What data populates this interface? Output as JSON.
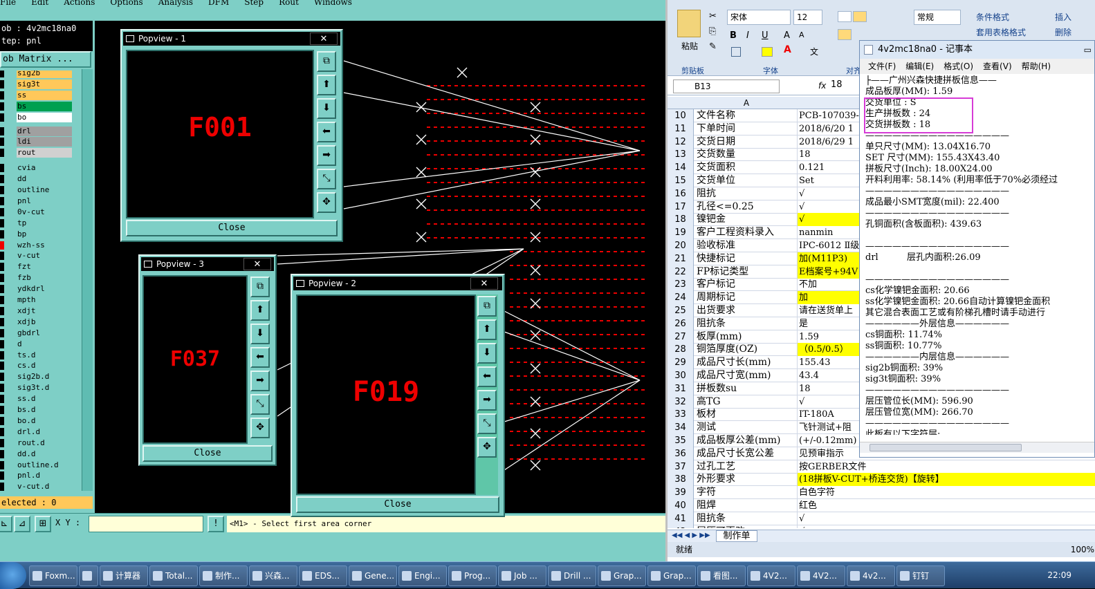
{
  "cam": {
    "menu": [
      "File",
      "Edit",
      "Actions",
      "Options",
      "Analysis",
      "DFM",
      "Step",
      "Rout",
      "Windows"
    ],
    "job_line": "ob : 4v2mc18na0",
    "step_line": "tep: pnl",
    "job_matrix_label": "ob Matrix ...",
    "layers": [
      {
        "name": "sig2b",
        "color": "#ffc85a"
      },
      {
        "name": "sig3t",
        "color": "#ffc85a"
      },
      {
        "name": "ss",
        "color": "#ffc85a"
      },
      {
        "name": "bs",
        "color": "#00a050"
      },
      {
        "name": "bo",
        "color": "#ffffff"
      },
      {
        "name": "drl",
        "color": "#a0a0a0"
      },
      {
        "name": "ldi",
        "color": "#a0a0a0"
      },
      {
        "name": "rout",
        "color": "#d0d0d0"
      },
      {
        "name": "cvia",
        "color": "#7ecfc6"
      },
      {
        "name": "dd",
        "color": "#7ecfc6"
      },
      {
        "name": "outline",
        "color": "#7ecfc6"
      },
      {
        "name": "pnl",
        "color": "#7ecfc6"
      },
      {
        "name": "0v-cut",
        "color": "#7ecfc6"
      },
      {
        "name": "tp",
        "color": "#7ecfc6"
      },
      {
        "name": "bp",
        "color": "#7ecfc6"
      },
      {
        "name": "wzh-ss",
        "color": "#7ecfc6"
      },
      {
        "name": "v-cut",
        "color": "#7ecfc6"
      },
      {
        "name": "fzt",
        "color": "#7ecfc6"
      },
      {
        "name": "fzb",
        "color": "#7ecfc6"
      },
      {
        "name": "ydkdrl",
        "color": "#7ecfc6"
      },
      {
        "name": "mpth",
        "color": "#7ecfc6"
      },
      {
        "name": "xdjt",
        "color": "#7ecfc6"
      },
      {
        "name": "xdjb",
        "color": "#7ecfc6"
      },
      {
        "name": "gbdrl",
        "color": "#7ecfc6"
      },
      {
        "name": "d",
        "color": "#7ecfc6"
      },
      {
        "name": "ts.d",
        "color": "#7ecfc6"
      },
      {
        "name": "cs.d",
        "color": "#7ecfc6"
      },
      {
        "name": "sig2b.d",
        "color": "#7ecfc6"
      },
      {
        "name": "sig3t.d",
        "color": "#7ecfc6"
      },
      {
        "name": "ss.d",
        "color": "#7ecfc6"
      },
      {
        "name": "bs.d",
        "color": "#7ecfc6"
      },
      {
        "name": "bo.d",
        "color": "#7ecfc6"
      },
      {
        "name": "drl.d",
        "color": "#7ecfc6"
      },
      {
        "name": "rout.d",
        "color": "#7ecfc6"
      },
      {
        "name": "dd.d",
        "color": "#7ecfc6"
      },
      {
        "name": "outline.d",
        "color": "#7ecfc6"
      },
      {
        "name": "pnl.d",
        "color": "#7ecfc6"
      },
      {
        "name": "v-cut.d",
        "color": "#7ecfc6"
      }
    ],
    "selected_text": "elected : 0",
    "xy_label": "X Y :",
    "prompt_text": "<M1> - Select first area corner",
    "popups": [
      {
        "title": "Popview - 1",
        "label": "F001",
        "close": "Close"
      },
      {
        "title": "Popview - 3",
        "label": "F037",
        "close": "Close"
      },
      {
        "title": "Popview - 2",
        "label": "F019",
        "close": "Close"
      }
    ]
  },
  "excel": {
    "font_name": "宋体",
    "font_size": "12",
    "number_format": "常规",
    "paste_label": "粘贴",
    "groups": [
      "剪贴板",
      "字体",
      "对齐"
    ],
    "cond_format": "条件格式",
    "table_format": "套用表格格式",
    "insert_label": "插入",
    "delete_label": "删除",
    "cell_ref": "B13",
    "fx": "fx",
    "formula_value": "18",
    "col_a": "A",
    "rows": [
      {
        "n": "10",
        "a": "文件名称",
        "b": "PCB-107039-"
      },
      {
        "n": "11",
        "a": "下单时间",
        "b": "2018/6/20 1"
      },
      {
        "n": "12",
        "a": "交货日期",
        "b": "2018/6/29 1"
      },
      {
        "n": "13",
        "a": "交货数量",
        "b": "18"
      },
      {
        "n": "14",
        "a": "交货面积",
        "b": "0.121"
      },
      {
        "n": "15",
        "a": "交货单位",
        "b": "Set"
      },
      {
        "n": "16",
        "a": "阻抗",
        "b": "√"
      },
      {
        "n": "17",
        "a": "孔径<=0.25",
        "b": "√"
      },
      {
        "n": "18",
        "a": "镍钯金",
        "b": "√",
        "hl": true
      },
      {
        "n": "19",
        "a": "客户工程资料录入",
        "b": "nanmin"
      },
      {
        "n": "20",
        "a": "验收标准",
        "b": "IPC-6012 Ⅱ级"
      },
      {
        "n": "21",
        "a": "快捷标记",
        "b": "加(M11P3)",
        "hl": true
      },
      {
        "n": "22",
        "a": "FP标记类型",
        "b": "E档案号+94V",
        "hl": true
      },
      {
        "n": "23",
        "a": "客户标记",
        "b": "不加"
      },
      {
        "n": "24",
        "a": "周期标记",
        "b": "加",
        "hl": true
      },
      {
        "n": "25",
        "a": "出货要求",
        "b": "请在送货单上"
      },
      {
        "n": "26",
        "a": "阻抗条",
        "b": "是"
      },
      {
        "n": "27",
        "a": "板厚(mm)",
        "b": "1.59"
      },
      {
        "n": "28",
        "a": "铜箔厚度(OZ)",
        "b": "（0.5/0.5）",
        "hl": true
      },
      {
        "n": "29",
        "a": "成品尺寸长(mm)",
        "b": "155.43"
      },
      {
        "n": "30",
        "a": "成品尺寸宽(mm)",
        "b": "43.4"
      },
      {
        "n": "31",
        "a": "拼板数su",
        "b": "18"
      },
      {
        "n": "32",
        "a": "高TG",
        "b": "√"
      },
      {
        "n": "33",
        "a": "板材",
        "b": "IT-180A"
      },
      {
        "n": "34",
        "a": "测试",
        "b": "飞针测试+阻"
      },
      {
        "n": "35",
        "a": "成品板厚公差(mm)",
        "b": "(+/-0.12mm)"
      },
      {
        "n": "36",
        "a": "成品尺寸长宽公差",
        "b": "见预审指示"
      },
      {
        "n": "37",
        "a": "过孔工艺",
        "b": "按GERBER文件"
      },
      {
        "n": "38",
        "a": "外形要求",
        "b": "(18拼板V-CUT+桥连交货)【旋转】",
        "hl": true
      },
      {
        "n": "39",
        "a": "字符",
        "b": "白色字符"
      },
      {
        "n": "40",
        "a": "阻焊",
        "b": "红色"
      },
      {
        "n": "41",
        "a": "阻抗条",
        "b": "√"
      },
      {
        "n": "42",
        "a": "层压可更改",
        "b": "√"
      }
    ],
    "sheet_tab": "制作单",
    "status": "就绪",
    "zoom": "100%"
  },
  "notepad": {
    "title": "4v2mc18na0 - 记事本",
    "menu": [
      "文件(F)",
      "编辑(E)",
      "格式(O)",
      "查看(V)",
      "帮助(H)"
    ],
    "lines": [
      "├——广州兴森快捷拼板信息——",
      "成品板厚(MM): 1.59",
      "交货单位 : S",
      "生产拼板数 : 24",
      "交货拼板数 : 18",
      "————————————————",
      "单只尺寸(MM): 13.04X16.70",
      "SET 尺寸(MM): 155.43X43.40",
      "拼板尺寸(Inch): 18.00X24.00",
      "开料利用率: 58.14% (利用率低于70%必须经过",
      "————————————————",
      "成品最小SMT宽度(mil): 22.400",
      "————————————————",
      "孔铜面积(含板面积): 439.63",
      "",
      "————————————————",
      "drl          层孔内面积:26.09",
      "",
      "————————————————",
      "cs化学镍钯金面积: 20.66",
      "ss化学镍钯金面积: 20.66自动计算镍钯金面积",
      "其它混合表面工艺或有阶梯孔槽时请手动进行",
      "——————外层信息——————",
      "cs铜面积: 11.74%",
      "ss铜面积: 10.77%",
      "——————内层信息——————",
      "sig2b铜面积: 39%",
      "sig3t铜面积: 39%",
      "————————————————",
      "层压管位长(MM): 596.90",
      "层压管位宽(MM): 266.70",
      "————————————————",
      "此板有以下字符层:"
    ]
  },
  "taskbar": {
    "items": [
      "Foxm...",
      "",
      "计算器",
      "Total...",
      "制作...",
      "兴森...",
      "EDS...",
      "Gene...",
      "Engi...",
      "Prog...",
      "Job ...",
      "Drill ...",
      "Grap...",
      "Grap...",
      "看图...",
      "4V2...",
      "4V2...",
      "4v2...",
      "钉钉"
    ],
    "clock": "22:09"
  }
}
